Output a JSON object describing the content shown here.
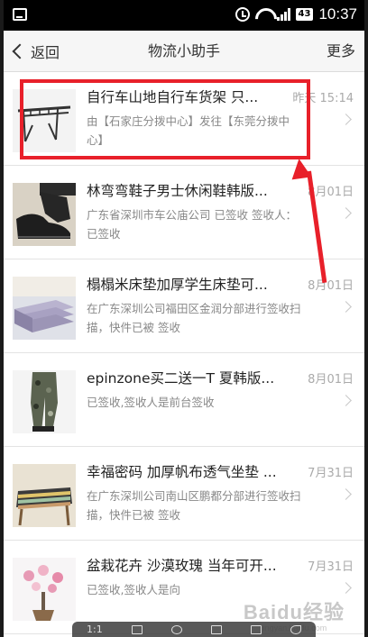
{
  "status_bar": {
    "time": "10:37",
    "battery": "43"
  },
  "nav": {
    "back_label": "返回",
    "title": "物流小助手",
    "more_label": "更多"
  },
  "items": [
    {
      "title": "自行车山地自行车货架 只...",
      "date": "昨天 15:14",
      "desc": "由【石家庄分拨中心】发往【东莞分拨中心】",
      "thumb": "bike-rack"
    },
    {
      "title": "林弯弯鞋子男士休闲鞋韩版...",
      "date": "8月01日",
      "desc": "广东省深圳市车公庙公司 已签收 签收人：已签收",
      "thumb": "shoes"
    },
    {
      "title": "榻榻米床垫加厚学生床垫可...",
      "date": "8月01日",
      "desc": "在广东深圳公司福田区金润分部进行签收扫描，快件已被 签收",
      "thumb": "mattress"
    },
    {
      "title": "epinzone买二送一T 夏韩版...",
      "date": "8月01日",
      "desc": "已签收,签收人是前台签收",
      "thumb": "pants"
    },
    {
      "title": "幸福密码 加厚帆布透气坐垫 ...",
      "date": "7月31日",
      "desc": "在广东深圳公司南山区鹏都分部进行签收扫描，快件已被 签收",
      "thumb": "cushion"
    },
    {
      "title": "盆栽花卉 沙漠玫瑰 当年可开...",
      "date": "7月31日",
      "desc": "已签收,签收人是向",
      "thumb": "plant"
    }
  ],
  "toolbar": {
    "ratio_label": "1:1"
  },
  "watermark": {
    "main": "Baidu经验",
    "sub": "jingyan.baidu.com"
  },
  "colors": {
    "highlight": "#e8202a",
    "nav_bg": "#f6f6f6"
  }
}
